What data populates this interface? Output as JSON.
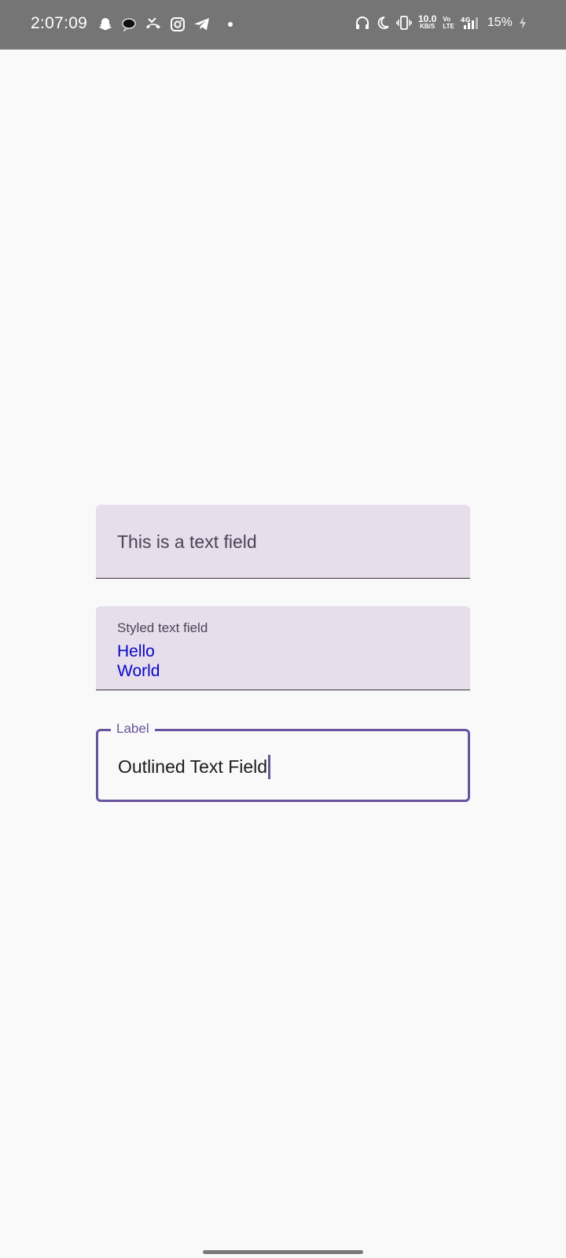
{
  "status_bar": {
    "time": "2:07:09",
    "network_speed_value": "10.0",
    "network_speed_unit": "KB/S",
    "volte_top": "Vo",
    "volte_bottom": "LTE",
    "battery_percent": "15%",
    "notification_icons": [
      "snapchat-icon",
      "chat-bubble-icon",
      "missed-call-icon",
      "instagram-icon",
      "telegram-icon",
      "more-dot-icon"
    ],
    "system_icons": [
      "headphones-icon",
      "do-not-disturb-icon",
      "vibrate-icon",
      "network-speed",
      "volte-icon",
      "signal-4g-icon",
      "battery-charging-icon"
    ]
  },
  "fields": {
    "plain": {
      "value": "This is a text field"
    },
    "styled": {
      "label": "Styled text field",
      "value": "Hello\nWorld",
      "value_color": "#0707c5"
    },
    "outlined": {
      "label": "Label",
      "value": "Outlined Text Field",
      "accent_color": "#67539f",
      "focused": true
    }
  },
  "colors": {
    "background": "#f9f9f9",
    "status_bar": "#757575",
    "filled_field_bg": "#e7deec"
  }
}
